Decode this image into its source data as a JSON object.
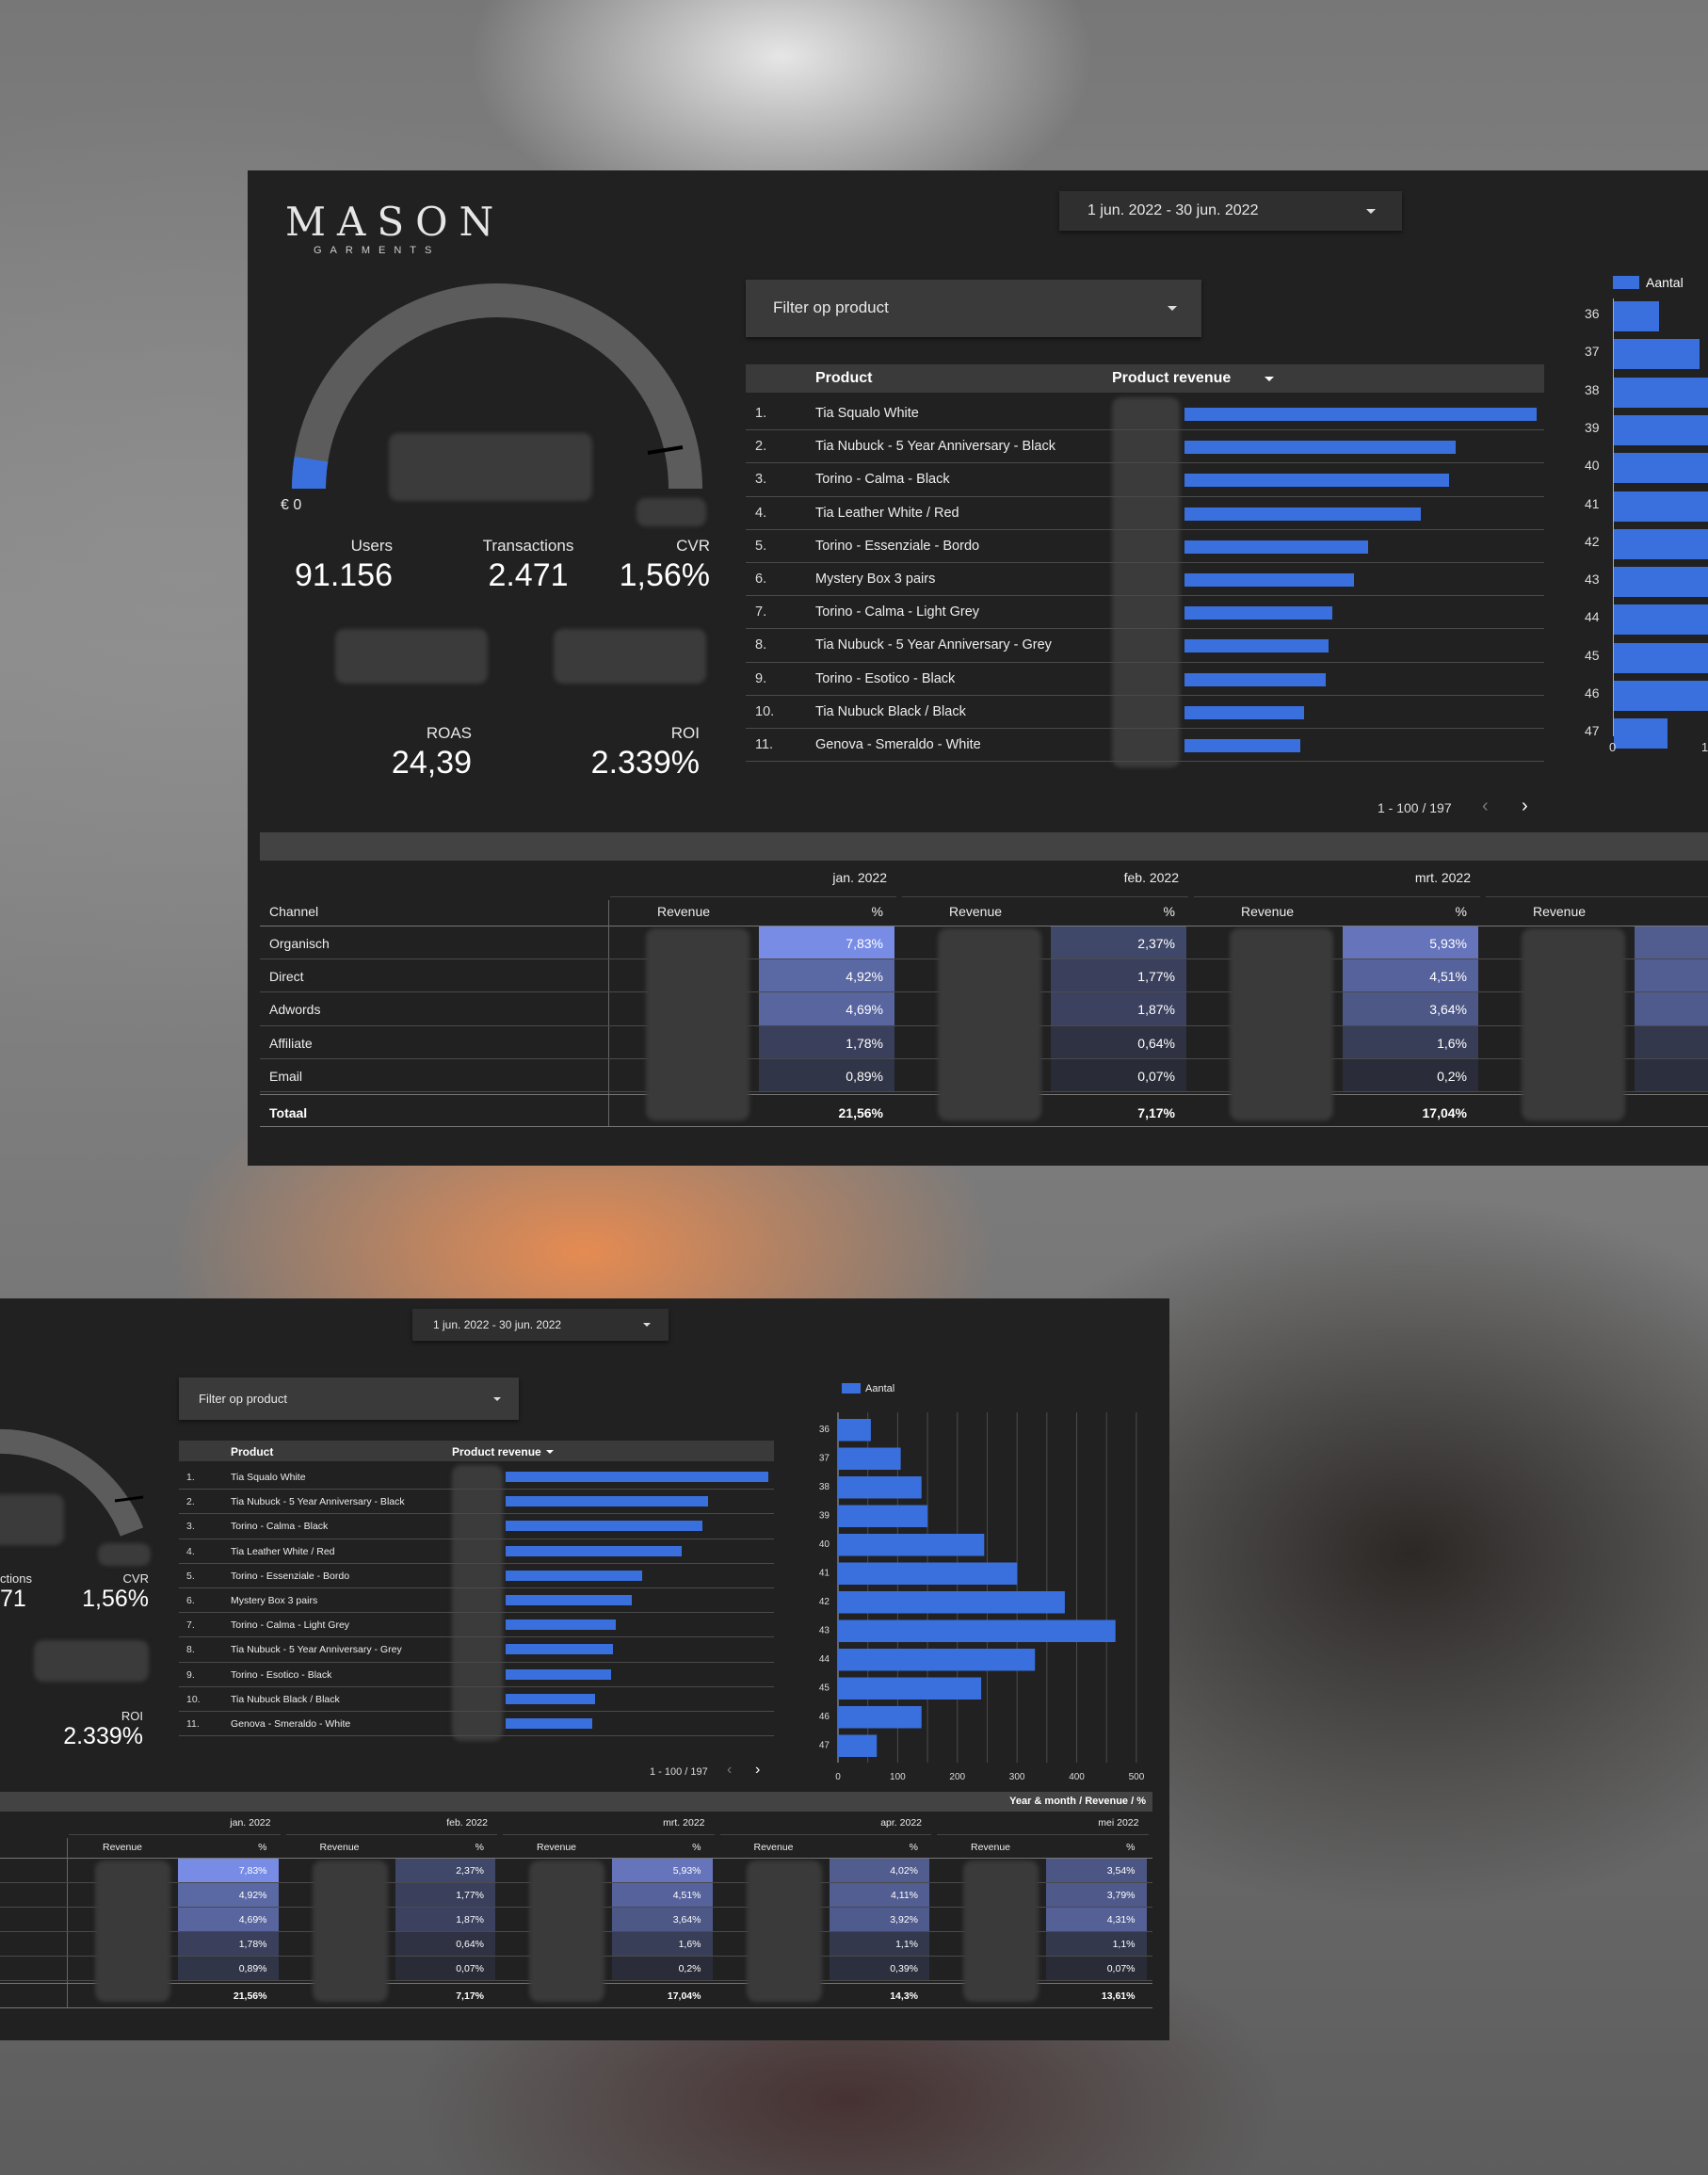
{
  "logo": {
    "name": "MASON",
    "sub": "GARMENTS"
  },
  "date_range": "1 jun. 2022 - 30 jun. 2022",
  "filter": {
    "placeholder": "Filter op product"
  },
  "gauge": {
    "min_label": "€ 0",
    "fill_fraction": 0.05
  },
  "kpis": {
    "users": {
      "label": "Users",
      "value": "91.156"
    },
    "transactions": {
      "label": "Transactions",
      "value": "2.471"
    },
    "transactions_partial": {
      "label": "ctions",
      "value": "71"
    },
    "cvr": {
      "label": "CVR",
      "value": "1,56%"
    },
    "roas": {
      "label": "ROAS",
      "value": "24,39"
    },
    "roi": {
      "label": "ROI",
      "value": "2.339%"
    }
  },
  "products_table": {
    "col_product": "Product",
    "col_revenue": "Product revenue",
    "rows": [
      {
        "rank": "1.",
        "name": "Tia Squalo White",
        "rel": 1.0
      },
      {
        "rank": "2.",
        "name": "Tia Nubuck - 5 Year Anniversary - Black",
        "rel": 0.77
      },
      {
        "rank": "3.",
        "name": "Torino - Calma - Black",
        "rel": 0.75
      },
      {
        "rank": "4.",
        "name": "Tia Leather White / Red",
        "rel": 0.67
      },
      {
        "rank": "5.",
        "name": "Torino - Essenziale - Bordo",
        "rel": 0.52
      },
      {
        "rank": "6.",
        "name": "Mystery Box 3 pairs",
        "rel": 0.48
      },
      {
        "rank": "7.",
        "name": "Torino - Calma - Light Grey",
        "rel": 0.42
      },
      {
        "rank": "8.",
        "name": "Tia Nubuck - 5 Year Anniversary - Grey",
        "rel": 0.41
      },
      {
        "rank": "9.",
        "name": "Torino - Esotico - Black",
        "rel": 0.4
      },
      {
        "rank": "10.",
        "name": "Tia Nubuck Black / Black",
        "rel": 0.34
      },
      {
        "rank": "11.",
        "name": "Genova - Smeraldo - White",
        "rel": 0.33
      }
    ],
    "pagination": "1 - 100 / 197"
  },
  "chart_data": {
    "type": "bar",
    "orientation": "horizontal",
    "series": [
      {
        "name": "Aantal",
        "values": [
          55,
          105,
          140,
          150,
          245,
          300,
          380,
          465,
          330,
          240,
          140,
          65
        ]
      }
    ],
    "categories": [
      "36",
      "37",
      "38",
      "39",
      "40",
      "41",
      "42",
      "43",
      "44",
      "45",
      "46",
      "47"
    ],
    "x_ticks": [
      "0",
      "100",
      "200",
      "300",
      "400",
      "500"
    ],
    "xlim": [
      0,
      520
    ],
    "grid": true,
    "legend": "top-left",
    "color": "#3a70de"
  },
  "revenue_table": {
    "title": "Year & month / Revenue / %",
    "col_channel": "Channel",
    "col_revenue": "Revenue",
    "col_pct": "%",
    "total_label": "Totaal",
    "months": [
      {
        "name": "jan. 2022",
        "pcts": [
          "7,83%",
          "4,92%",
          "4,69%",
          "1,78%",
          "0,89%"
        ],
        "total": "21,56%"
      },
      {
        "name": "feb. 2022",
        "pcts": [
          "2,37%",
          "1,77%",
          "1,87%",
          "0,64%",
          "0,07%"
        ],
        "total": "7,17%"
      },
      {
        "name": "mrt. 2022",
        "pcts": [
          "5,93%",
          "4,51%",
          "3,64%",
          "1,6%",
          "0,2%"
        ],
        "total": "17,04%"
      },
      {
        "name": "apr. 2022",
        "pcts": [
          "4,02%",
          "4,11%",
          "3,92%",
          "1,1%",
          "0,39%"
        ],
        "total": "14,3%"
      },
      {
        "name": "mei 2022",
        "pcts": [
          "3,54%",
          "3,79%",
          "4,31%",
          "1,1%",
          "0,07%"
        ],
        "total": "13,61%"
      }
    ],
    "channels": [
      "Organisch",
      "Direct",
      "Adwords",
      "Affiliate",
      "Email"
    ]
  },
  "top_partial_chart": {
    "legend_partial": "Aantal",
    "x_ticks": [
      "0",
      "1"
    ]
  },
  "top_partial_month": "apr."
}
